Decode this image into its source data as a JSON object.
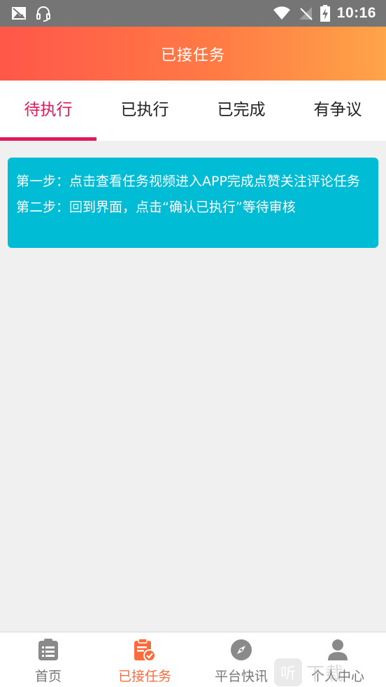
{
  "status_bar": {
    "time": "10:16",
    "icons": [
      "no-image-notification-icon",
      "headset-notification-icon",
      "wifi-icon",
      "no-signal-icon",
      "battery-charging-icon"
    ]
  },
  "header": {
    "title": "已接任务"
  },
  "tabs": [
    {
      "label": "待执行",
      "active": true
    },
    {
      "label": "已执行",
      "active": false
    },
    {
      "label": "已完成",
      "active": false
    },
    {
      "label": "有争议",
      "active": false
    }
  ],
  "instructions": {
    "step1": "第一步：点击查看任务视频进入APP完成点赞关注评论任务",
    "step2": "第二步：回到界面，点击“确认已执行”等待审核"
  },
  "bottom_nav": [
    {
      "label": "首页",
      "icon": "list-icon",
      "active": false
    },
    {
      "label": "已接任务",
      "icon": "clipboard-check-icon",
      "active": true
    },
    {
      "label": "平台快讯",
      "icon": "compass-icon",
      "active": false
    },
    {
      "label": "个人中心",
      "icon": "user-icon",
      "active": false
    }
  ],
  "watermark": {
    "badge": "听",
    "text": "下载"
  },
  "colors": {
    "accent": "#e1195a",
    "header_gradient_start": "#ff5749",
    "header_gradient_end": "#ffa448",
    "card": "#00bcd4",
    "nav_active": "#ff6a3c",
    "nav_inactive": "#8a8a8a"
  }
}
